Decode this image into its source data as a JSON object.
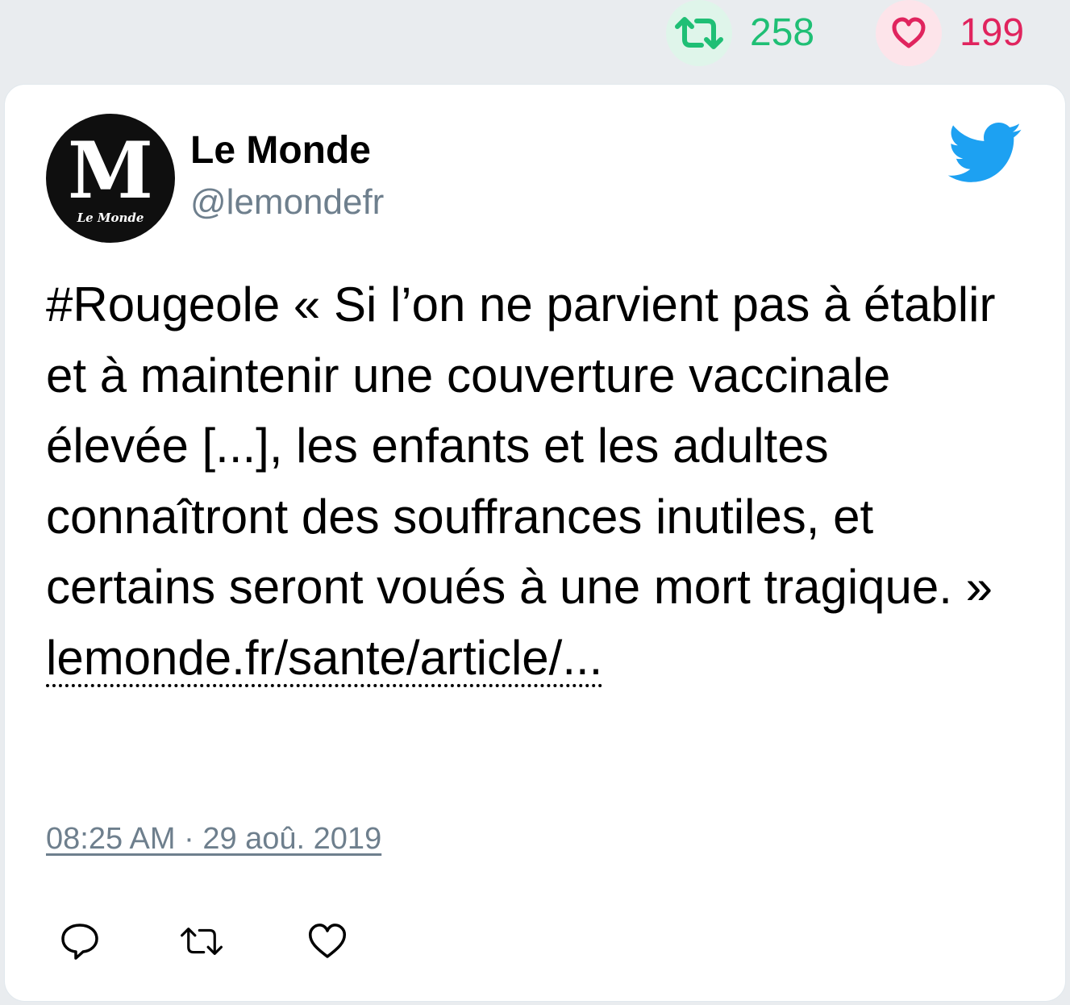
{
  "stats": {
    "retweets": "258",
    "likes": "199",
    "retweet_icon": "retweet-icon",
    "like_icon": "heart-icon",
    "retweet_color": "#1fbf75",
    "like_color": "#e0245e"
  },
  "tweet": {
    "author_name": "Le Monde",
    "author_handle": "@lemondefr",
    "avatar_icon": "le-monde-logo",
    "brand_icon": "twitter-bird-icon",
    "brand_color": "#1da1f2",
    "text": "#Rougeole « Si l’on ne parvient pas à établir et à maintenir une couverture vaccinale élevée [...], les enfants et les adultes connaîtront des souffrances inutiles, et certains seront voués à une mort tragique. »",
    "link": "lemonde.fr/sante/article/...",
    "timestamp": "08:25 AM · 29 aoû. 2019"
  },
  "actions": {
    "reply_icon": "reply-icon",
    "retweet_icon": "retweet-icon",
    "like_icon": "heart-icon"
  }
}
